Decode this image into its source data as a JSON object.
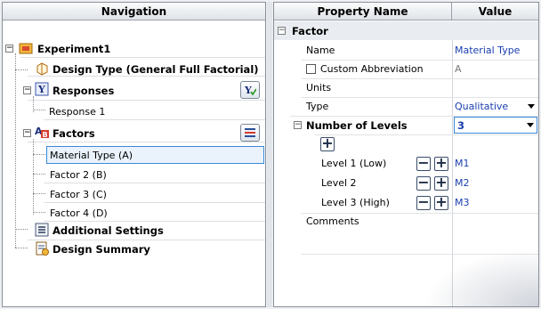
{
  "navigation": {
    "header": "Navigation",
    "experiment": "Experiment1",
    "design_type": "Design Type (General Full Factorial)",
    "responses": "Responses",
    "response_items": [
      "Response 1"
    ],
    "factors": "Factors",
    "factor_items": [
      "Material Type (A)",
      "Factor 2 (B)",
      "Factor 3 (C)",
      "Factor 4 (D)"
    ],
    "additional_settings": "Additional Settings",
    "design_summary": "Design Summary"
  },
  "properties": {
    "header_name": "Property Name",
    "header_value": "Value",
    "category": "Factor",
    "name_label": "Name",
    "name_value": "Material Type",
    "custom_abbrev_label": "Custom Abbreviation",
    "custom_abbrev_value": "A",
    "units_label": "Units",
    "units_value": "",
    "type_label": "Type",
    "type_value": "Qualitative",
    "levels_label": "Number of Levels",
    "levels_value": "3",
    "levels": [
      {
        "label": "Level 1 (Low)",
        "value": "M1"
      },
      {
        "label": "Level 2",
        "value": "M2"
      },
      {
        "label": "Level 3 (High)",
        "value": "M3"
      }
    ],
    "comments_label": "Comments"
  },
  "colors": {
    "accent": "#1a3fb0",
    "selection": "#3b8ad9"
  }
}
